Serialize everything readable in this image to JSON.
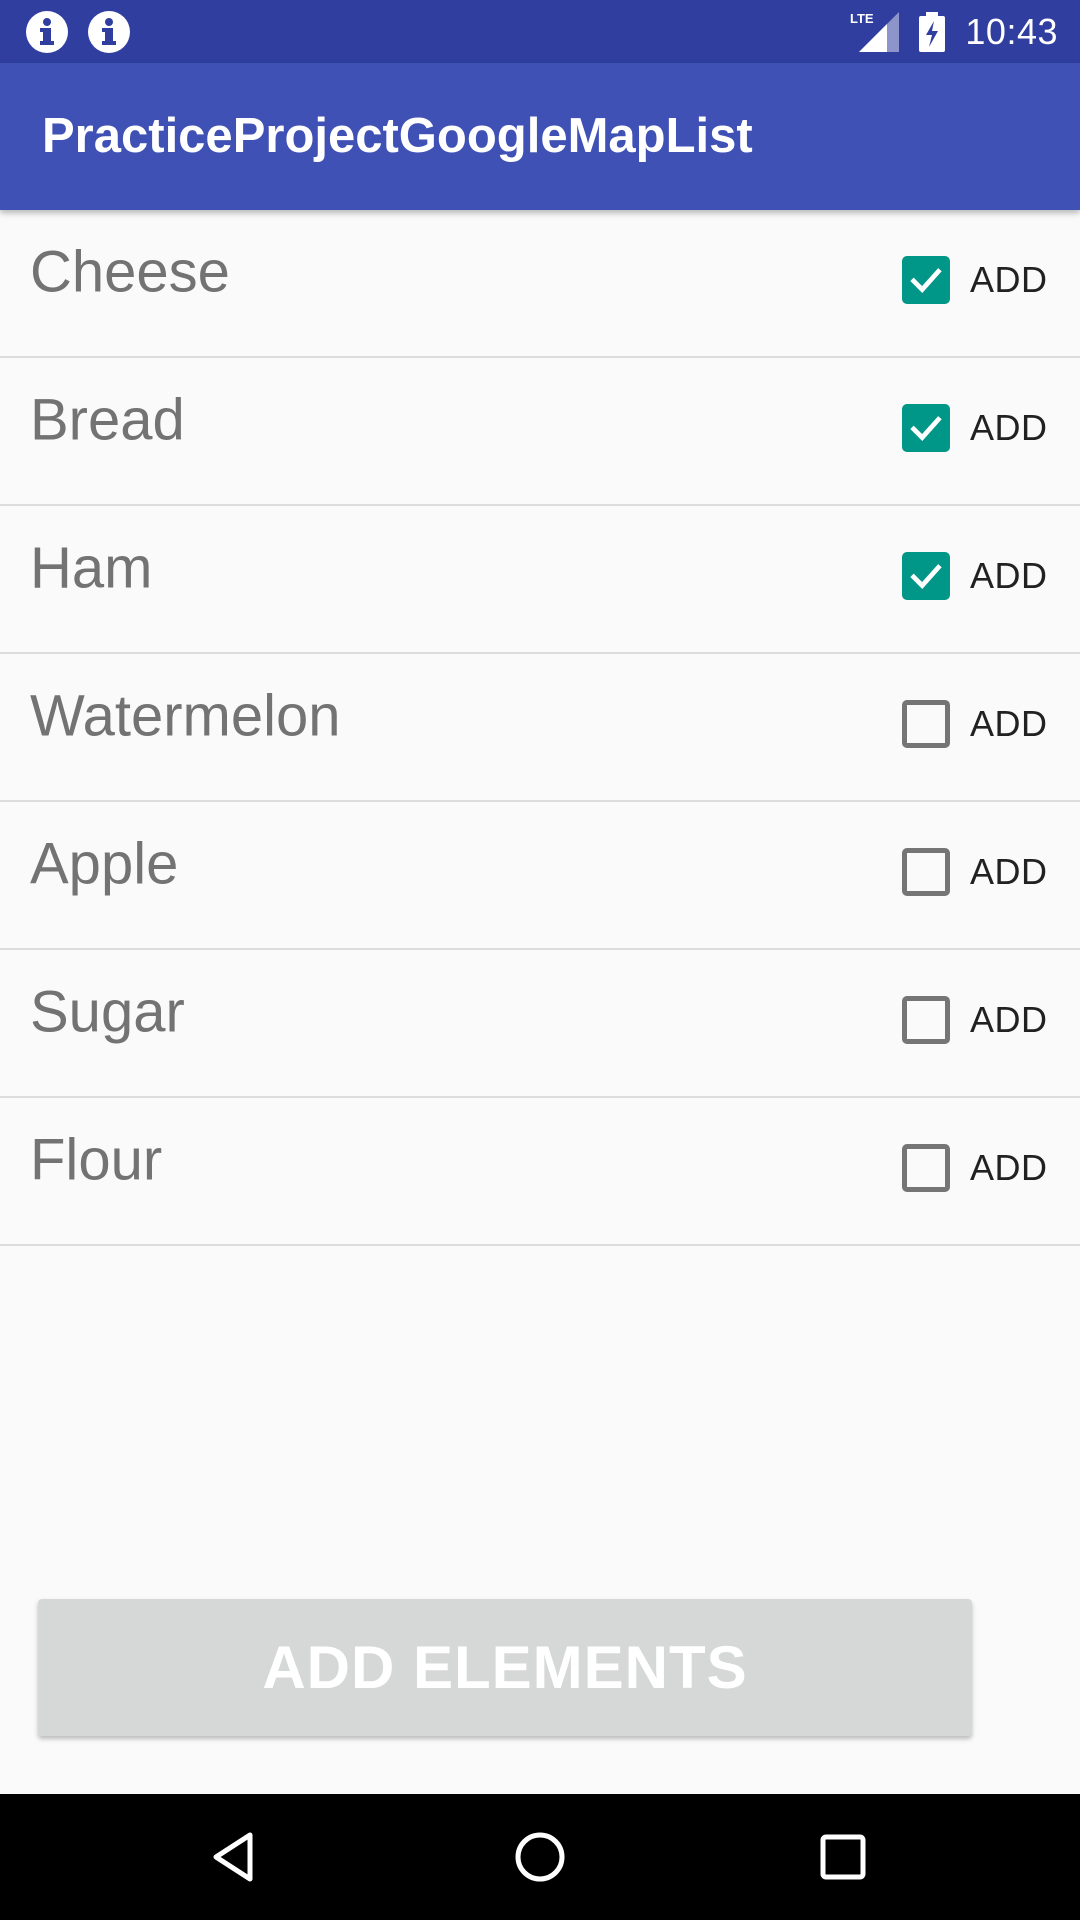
{
  "status_bar": {
    "time": "10:43",
    "notification_icons": [
      "info-icon",
      "info-icon"
    ],
    "network_label": "LTE",
    "background_color": "#303f9f"
  },
  "app_bar": {
    "title": "PracticeProjectGoogleMapList",
    "background_color": "#3f51b5"
  },
  "list": {
    "items": [
      {
        "name": "Cheese",
        "checkbox_label": "ADD",
        "checked": true
      },
      {
        "name": "Bread",
        "checkbox_label": "ADD",
        "checked": true
      },
      {
        "name": "Ham",
        "checkbox_label": "ADD",
        "checked": true
      },
      {
        "name": "Watermelon",
        "checkbox_label": "ADD",
        "checked": false
      },
      {
        "name": "Apple",
        "checkbox_label": "ADD",
        "checked": false
      },
      {
        "name": "Sugar",
        "checkbox_label": "ADD",
        "checked": false
      },
      {
        "name": "Flour",
        "checkbox_label": "ADD",
        "checked": false
      }
    ],
    "checked_color": "#009688"
  },
  "action_button": {
    "label": "ADD ELEMENTS",
    "enabled": false
  },
  "nav_bar": {
    "buttons": [
      "back-icon",
      "home-icon",
      "recents-icon"
    ]
  }
}
